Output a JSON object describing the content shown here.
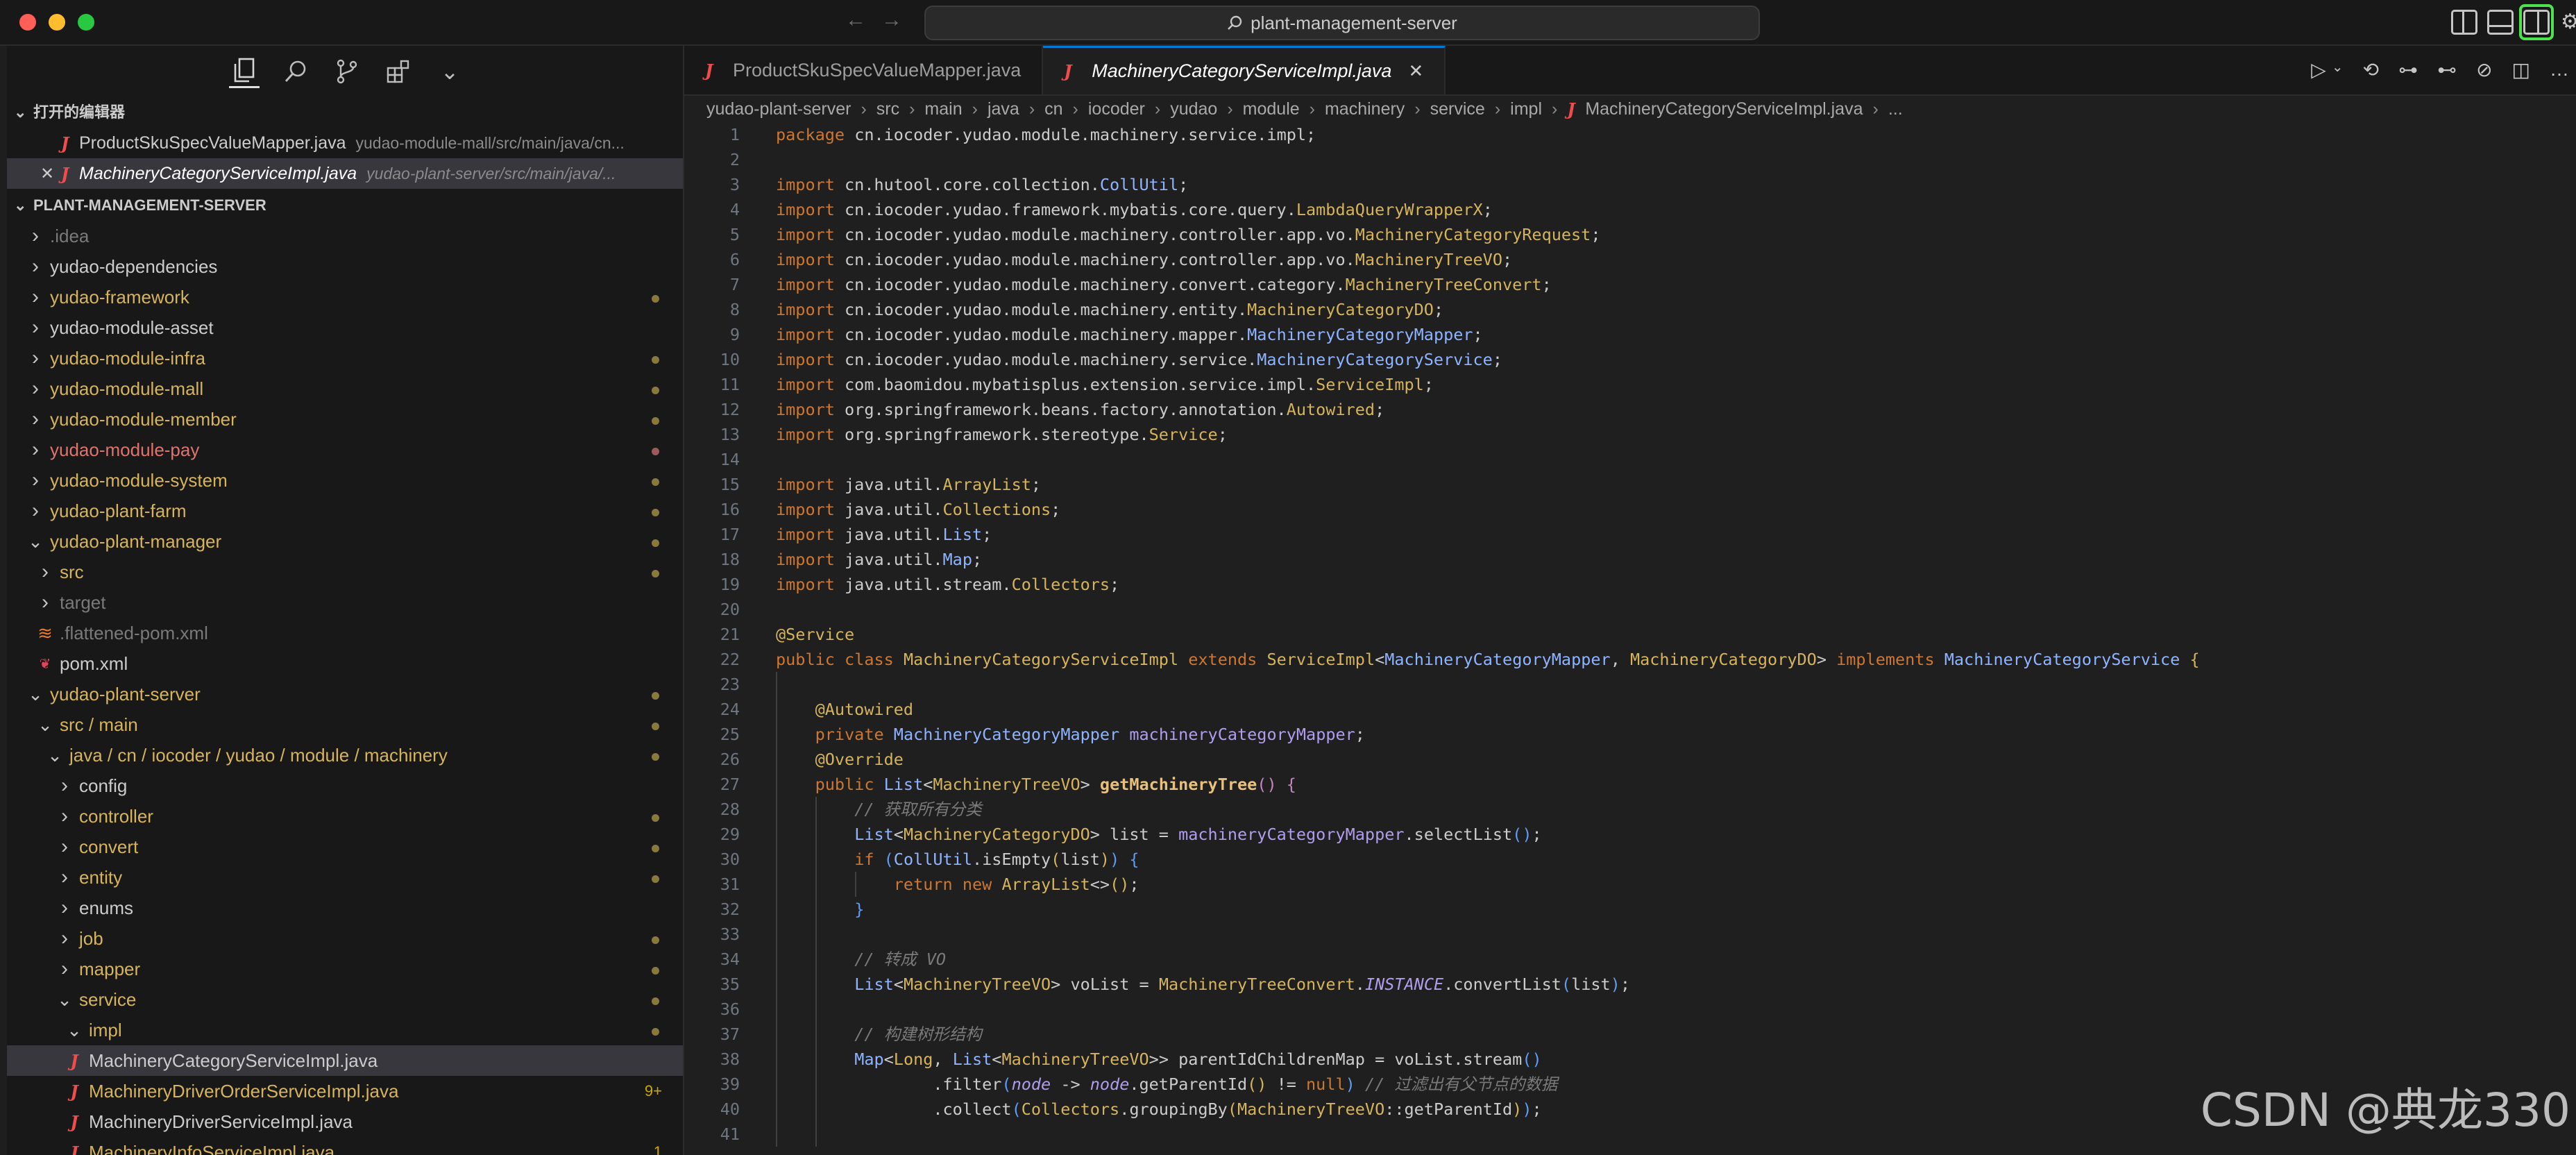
{
  "window": {
    "search_text": "plant-management-server"
  },
  "activity_bar": [
    "explorer-icon",
    "search-icon",
    "source-control-icon",
    "extensions-icon",
    "chevron-down-icon"
  ],
  "open_editors": {
    "title": "打开的编辑器",
    "items": [
      {
        "name": "ProductSkuSpecValueMapper.java",
        "path": "yudao-module-mall/src/main/java/cn..."
      },
      {
        "name": "MachineryCategoryServiceImpl.java",
        "path": "yudao-plant-server/src/main/java/..."
      }
    ]
  },
  "explorer": {
    "title": "PLANT-MANAGEMENT-SERVER",
    "tree": [
      {
        "label": ".idea",
        "indent": 1,
        "kind": "folder",
        "open": false,
        "color": "grey",
        "dot": ""
      },
      {
        "label": "yudao-dependencies",
        "indent": 1,
        "kind": "folder",
        "open": false,
        "color": "white",
        "dot": ""
      },
      {
        "label": "yudao-framework",
        "indent": 1,
        "kind": "folder",
        "open": false,
        "color": "gold",
        "dot": "gold"
      },
      {
        "label": "yudao-module-asset",
        "indent": 1,
        "kind": "folder",
        "open": false,
        "color": "white",
        "dot": ""
      },
      {
        "label": "yudao-module-infra",
        "indent": 1,
        "kind": "folder",
        "open": false,
        "color": "gold",
        "dot": "gold"
      },
      {
        "label": "yudao-module-mall",
        "indent": 1,
        "kind": "folder",
        "open": false,
        "color": "gold",
        "dot": "gold"
      },
      {
        "label": "yudao-module-member",
        "indent": 1,
        "kind": "folder",
        "open": false,
        "color": "gold",
        "dot": "gold"
      },
      {
        "label": "yudao-module-pay",
        "indent": 1,
        "kind": "folder",
        "open": false,
        "color": "red",
        "dot": "red"
      },
      {
        "label": "yudao-module-system",
        "indent": 1,
        "kind": "folder",
        "open": false,
        "color": "gold",
        "dot": "gold"
      },
      {
        "label": "yudao-plant-farm",
        "indent": 1,
        "kind": "folder",
        "open": false,
        "color": "gold",
        "dot": "gold"
      },
      {
        "label": "yudao-plant-manager",
        "indent": 1,
        "kind": "folder",
        "open": true,
        "color": "gold",
        "dot": "gold"
      },
      {
        "label": "src",
        "indent": 2,
        "kind": "folder",
        "open": false,
        "color": "gold",
        "dot": "gold"
      },
      {
        "label": "target",
        "indent": 2,
        "kind": "folder",
        "open": false,
        "color": "grey",
        "dot": ""
      },
      {
        "label": ".flattened-pom.xml",
        "indent": 2,
        "kind": "xml",
        "open": false,
        "color": "grey",
        "dot": ""
      },
      {
        "label": "pom.xml",
        "indent": 2,
        "kind": "maven",
        "open": false,
        "color": "white",
        "dot": ""
      },
      {
        "label": "yudao-plant-server",
        "indent": 1,
        "kind": "folder",
        "open": true,
        "color": "gold",
        "dot": "gold"
      },
      {
        "label": "src / main",
        "indent": 2,
        "kind": "folder",
        "open": true,
        "color": "gold",
        "dot": "gold"
      },
      {
        "label": "java / cn / iocoder / yudao / module / machinery",
        "indent": 3,
        "kind": "folder",
        "open": true,
        "color": "gold",
        "dot": "gold"
      },
      {
        "label": "config",
        "indent": 4,
        "kind": "folder",
        "open": false,
        "color": "white",
        "dot": ""
      },
      {
        "label": "controller",
        "indent": 4,
        "kind": "folder",
        "open": false,
        "color": "gold",
        "dot": "gold"
      },
      {
        "label": "convert",
        "indent": 4,
        "kind": "folder",
        "open": false,
        "color": "gold",
        "dot": "gold"
      },
      {
        "label": "entity",
        "indent": 4,
        "kind": "folder",
        "open": false,
        "color": "gold",
        "dot": "gold"
      },
      {
        "label": "enums",
        "indent": 4,
        "kind": "folder",
        "open": false,
        "color": "white",
        "dot": ""
      },
      {
        "label": "job",
        "indent": 4,
        "kind": "folder",
        "open": false,
        "color": "gold",
        "dot": "gold"
      },
      {
        "label": "mapper",
        "indent": 4,
        "kind": "folder",
        "open": false,
        "color": "gold",
        "dot": "gold"
      },
      {
        "label": "service",
        "indent": 4,
        "kind": "folder",
        "open": true,
        "color": "gold",
        "dot": "gold"
      },
      {
        "label": "impl",
        "indent": 5,
        "kind": "folder",
        "open": true,
        "color": "gold",
        "dot": "gold"
      },
      {
        "label": "MachineryCategoryServiceImpl.java",
        "indent": 5,
        "kind": "java",
        "open": false,
        "color": "white",
        "dot": "",
        "selected": true
      },
      {
        "label": "MachineryDriverOrderServiceImpl.java",
        "indent": 5,
        "kind": "java",
        "open": false,
        "color": "gold",
        "dot": "",
        "badge": "9+"
      },
      {
        "label": "MachineryDriverServiceImpl.java",
        "indent": 5,
        "kind": "java",
        "open": false,
        "color": "white",
        "dot": ""
      },
      {
        "label": "MachineryInfoServiceImpl.java",
        "indent": 5,
        "kind": "java",
        "open": false,
        "color": "gold",
        "dot": "",
        "badge": "1"
      }
    ]
  },
  "tabs": [
    {
      "label": "ProductSkuSpecValueMapper.java",
      "active": false
    },
    {
      "label": "MachineryCategoryServiceImpl.java",
      "active": true
    }
  ],
  "breadcrumb": [
    "yudao-plant-server",
    "src",
    "main",
    "java",
    "cn",
    "iocoder",
    "yudao",
    "module",
    "machinery",
    "service",
    "impl",
    "MachineryCategoryServiceImpl.java",
    "..."
  ],
  "code_lines": [
    {
      "n": "1",
      "indent": 0,
      "html": "<span class='kw'>package</span> cn.iocoder.yudao.module.machinery.service.impl;"
    },
    {
      "n": "2",
      "indent": 0,
      "html": ""
    },
    {
      "n": "3",
      "indent": 0,
      "html": "<span class='kw'>import</span> cn.hutool.core.collection.<span class='iface'>CollUtil</span>;"
    },
    {
      "n": "4",
      "indent": 0,
      "html": "<span class='kw'>import</span> cn.iocoder.yudao.framework.mybatis.core.query.<span class='cls'>LambdaQueryWrapperX</span>;"
    },
    {
      "n": "5",
      "indent": 0,
      "html": "<span class='kw'>import</span> cn.iocoder.yudao.module.machinery.controller.app.vo.<span class='cls'>MachineryCategoryRequest</span>;"
    },
    {
      "n": "6",
      "indent": 0,
      "html": "<span class='kw'>import</span> cn.iocoder.yudao.module.machinery.controller.app.vo.<span class='cls'>MachineryTreeVO</span>;"
    },
    {
      "n": "7",
      "indent": 0,
      "html": "<span class='kw'>import</span> cn.iocoder.yudao.module.machinery.convert.category.<span class='cls'>MachineryTreeConvert</span>;"
    },
    {
      "n": "8",
      "indent": 0,
      "html": "<span class='kw'>import</span> cn.iocoder.yudao.module.machinery.entity.<span class='cls'>MachineryCategoryDO</span>;"
    },
    {
      "n": "9",
      "indent": 0,
      "html": "<span class='kw'>import</span> cn.iocoder.yudao.module.machinery.mapper.<span class='iface'>MachineryCategoryMapper</span>;"
    },
    {
      "n": "10",
      "indent": 0,
      "html": "<span class='kw'>import</span> cn.iocoder.yudao.module.machinery.service.<span class='iface'>MachineryCategoryService</span>;"
    },
    {
      "n": "11",
      "indent": 0,
      "html": "<span class='kw'>import</span> com.baomidou.mybatisplus.extension.service.impl.<span class='cls'>ServiceImpl</span>;"
    },
    {
      "n": "12",
      "indent": 0,
      "html": "<span class='kw'>import</span> org.springframework.beans.factory.annotation.<span class='cls'>Autowired</span>;"
    },
    {
      "n": "13",
      "indent": 0,
      "html": "<span class='kw'>import</span> org.springframework.stereotype.<span class='cls'>Service</span>;"
    },
    {
      "n": "14",
      "indent": 0,
      "html": ""
    },
    {
      "n": "15",
      "indent": 0,
      "html": "<span class='kw'>import</span> java.util.<span class='cls'>ArrayList</span>;"
    },
    {
      "n": "16",
      "indent": 0,
      "html": "<span class='kw'>import</span> java.util.<span class='cls'>Collections</span>;"
    },
    {
      "n": "17",
      "indent": 0,
      "html": "<span class='kw'>import</span> java.util.<span class='iface'>List</span>;"
    },
    {
      "n": "18",
      "indent": 0,
      "html": "<span class='kw'>import</span> java.util.<span class='iface'>Map</span>;"
    },
    {
      "n": "19",
      "indent": 0,
      "html": "<span class='kw'>import</span> java.util.stream.<span class='cls'>Collectors</span>;"
    },
    {
      "n": "20",
      "indent": 0,
      "html": ""
    },
    {
      "n": "21",
      "indent": 0,
      "html": "<span class='ann'>@Service</span>"
    },
    {
      "n": "22",
      "indent": 0,
      "html": "<span class='kw'>public</span> <span class='kw'>class</span> <span class='cls'>MachineryCategoryServiceImpl</span> <span class='kw'>extends</span> <span class='cls'>ServiceImpl</span>&lt;<span class='iface'>MachineryCategoryMapper</span>, <span class='cls'>MachineryCategoryDO</span>&gt; <span class='kw'>implements</span> <span class='iface'>MachineryCategoryService</span> <span class='cls'>{</span>"
    },
    {
      "n": "23",
      "indent": 1,
      "html": ""
    },
    {
      "n": "24",
      "indent": 1,
      "html": "    <span class='ann'>@Autowired</span>"
    },
    {
      "n": "25",
      "indent": 1,
      "html": "    <span class='kw'>private</span> <span class='iface'>MachineryCategoryMapper</span> <span class='fld'>machineryCategoryMapper</span>;"
    },
    {
      "n": "26",
      "indent": 1,
      "html": "    <span class='ann'>@Override</span>"
    },
    {
      "n": "27",
      "indent": 1,
      "html": "    <span class='kw'>public</span> <span class='iface'>List</span>&lt;<span class='cls'>MachineryTreeVO</span>&gt; <span class='meth'>getMachineryTree</span><span class='kw2'>()</span> <span class='kw2'>{</span>"
    },
    {
      "n": "28",
      "indent": 2,
      "html": "        <span class='cmt'>// 获取所有分类</span>"
    },
    {
      "n": "29",
      "indent": 2,
      "html": "        <span class='iface'>List</span>&lt;<span class='cls'>MachineryCategoryDO</span>&gt; list = <span class='fld'>machineryCategoryMapper</span>.selectList<span class='brk'>()</span>;"
    },
    {
      "n": "30",
      "indent": 2,
      "html": "        <span class='kw'>if</span> <span class='brk'>(</span><span class='iface'>CollUtil</span>.isEmpty<span class='cls'>(</span>list<span class='cls'>)</span><span class='brk'>)</span> <span class='brk'>{</span>"
    },
    {
      "n": "31",
      "indent": 3,
      "html": "            <span class='kw'>return</span> <span class='kw'>new</span> <span class='cls'>ArrayList</span>&lt;&gt;<span class='cls'>()</span>;"
    },
    {
      "n": "32",
      "indent": 2,
      "html": "        <span class='brk'>}</span>"
    },
    {
      "n": "33",
      "indent": 2,
      "html": ""
    },
    {
      "n": "34",
      "indent": 2,
      "html": "        <span class='cmt'>// 转成 VO</span>"
    },
    {
      "n": "35",
      "indent": 2,
      "html": "        <span class='iface'>List</span>&lt;<span class='cls'>MachineryTreeVO</span>&gt; voList = <span class='cls'>MachineryTreeConvert</span>.<span class='stat'>INSTANCE</span>.convertList<span class='brk'>(</span>list<span class='brk'>)</span>;"
    },
    {
      "n": "36",
      "indent": 2,
      "html": ""
    },
    {
      "n": "37",
      "indent": 2,
      "html": "        <span class='cmt'>// 构建树形结构</span>"
    },
    {
      "n": "38",
      "indent": 2,
      "html": "        <span class='iface'>Map</span>&lt;<span class='cls'>Long</span>, <span class='iface'>List</span>&lt;<span class='cls'>MachineryTreeVO</span>&gt;&gt; parentIdChildrenMap = voList.stream<span class='brk'>()</span>"
    },
    {
      "n": "39",
      "indent": 2,
      "html": "                .filter<span class='brk'>(</span><span class='stat'>node</span> -&gt; <span class='stat'>node</span>.getParentId<span class='cls'>()</span> != <span class='kw'>null</span><span class='brk'>)</span> <span class='cmt'>// 过滤出有父节点的数据</span>"
    },
    {
      "n": "40",
      "indent": 2,
      "html": "                .collect<span class='brk'>(</span><span class='cls'>Collectors</span>.groupingBy<span class='cls'>(</span><span class='cls'>MachineryTreeVO</span>::getParentId<span class='cls'>)</span><span class='brk'>)</span>;"
    },
    {
      "n": "41",
      "indent": 2,
      "html": ""
    }
  ],
  "watermark": "CSDN @典龙330"
}
